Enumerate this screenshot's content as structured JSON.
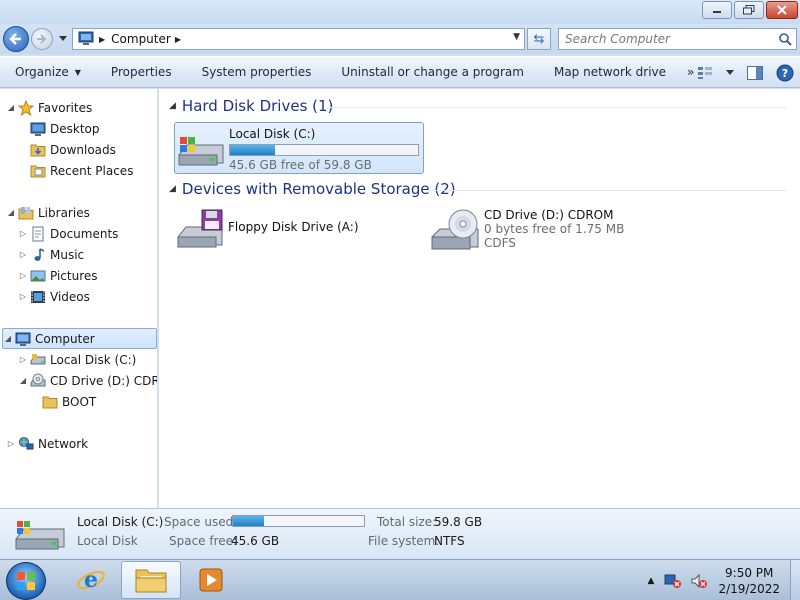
{
  "window": {
    "controls": {
      "minimize": "minimize-icon",
      "maximize": "restore-icon",
      "close": "close-icon"
    }
  },
  "address_bar": {
    "crumbs": [
      "Computer"
    ],
    "search_placeholder": "Search Computer"
  },
  "command_bar": {
    "organize": "Organize",
    "properties": "Properties",
    "system_properties": "System properties",
    "uninstall": "Uninstall or change a program",
    "map_drive": "Map network drive",
    "overflow": "»"
  },
  "nav_pane": {
    "favorites": {
      "label": "Favorites",
      "items": [
        "Desktop",
        "Downloads",
        "Recent Places"
      ]
    },
    "libraries": {
      "label": "Libraries",
      "items": [
        "Documents",
        "Music",
        "Pictures",
        "Videos"
      ]
    },
    "computer": {
      "label": "Computer",
      "items": [
        "Local Disk (C:)",
        "CD Drive (D:) CDROM"
      ],
      "subitems": [
        "BOOT"
      ]
    },
    "network": {
      "label": "Network"
    }
  },
  "content": {
    "hard_disks": {
      "header": "Hard Disk Drives (1)",
      "drives": [
        {
          "name": "Local Disk (C:)",
          "free_text": "45.6 GB free of 59.8 GB",
          "used_fraction": 0.237
        }
      ]
    },
    "removable": {
      "header": "Devices with Removable Storage (2)",
      "devices": [
        {
          "name": "Floppy Disk Drive (A:)"
        },
        {
          "name": "CD Drive (D:) CDROM",
          "free_text": "0 bytes free of 1.75 MB",
          "fs": "CDFS"
        }
      ]
    }
  },
  "details": {
    "name": "Local Disk (C:)",
    "type": "Local Disk",
    "space_used_label": "Space used:",
    "used_fraction": 0.237,
    "space_free_label": "Space free:",
    "space_free": "45.6 GB",
    "total_size_label": "Total size:",
    "total_size": "59.8 GB",
    "fs_label": "File system:",
    "fs": "NTFS"
  },
  "taskbar": {
    "time": "9:50 PM",
    "date": "2/19/2022"
  },
  "colors": {
    "accent_blue": "#1c7fcb",
    "group_header": "#1e3287",
    "selection_border": "#7da2ce"
  }
}
